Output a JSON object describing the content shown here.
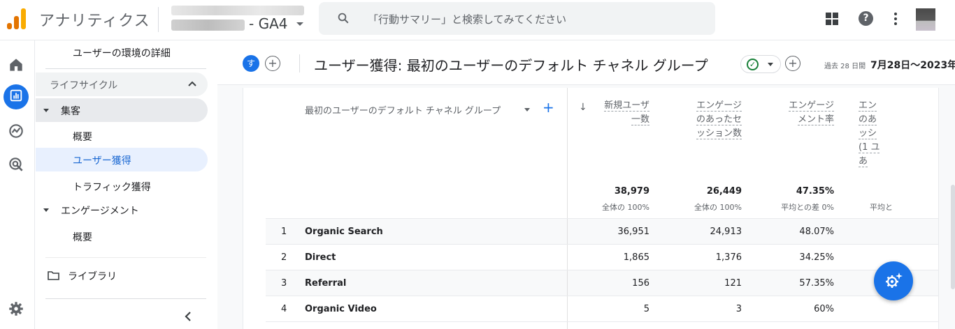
{
  "topbar": {
    "app_title": "アナリティクス",
    "property_name": "- GA4",
    "search_placeholder": "「行動サマリー」と検索してみてください"
  },
  "nav": {
    "item_env_detail": "ユーザーの環境の詳細",
    "lifecycle": "ライフサイクル",
    "acquisition": "集客",
    "acq_overview": "概要",
    "acq_user": "ユーザー獲得",
    "acq_traffic": "トラフィック獲得",
    "engagement": "エンゲージメント",
    "eng_overview": "概要",
    "library": "ライブラリ"
  },
  "header": {
    "badge": "す",
    "title": "ユーザー獲得: 最初のユーザーのデフォルト チャネル グループ",
    "date_prefix": "過去 28 日間",
    "date_range": "7月28日〜2023年8"
  },
  "table": {
    "dimension_label": "最初のユーザーのデフォルト チャネル グループ",
    "columns": [
      {
        "label": "新規ユーザ\n一数",
        "total": "38,979",
        "sub": "全体の 100%"
      },
      {
        "label": "エンゲージ\nのあったセ\nッション数",
        "total": "26,449",
        "sub": "全体の 100%"
      },
      {
        "label": "エンゲージ\nメント率",
        "total": "47.35%",
        "sub": "平均との差 0%"
      },
      {
        "label": "エン\nのあ\nッシ\n(1 ユ\nあ",
        "total": "",
        "sub": "平均と"
      }
    ],
    "rows": [
      {
        "idx": "1",
        "name": "Organic Search",
        "values": [
          "36,951",
          "24,913",
          "48.07%"
        ]
      },
      {
        "idx": "2",
        "name": "Direct",
        "values": [
          "1,865",
          "1,376",
          "34.25%"
        ]
      },
      {
        "idx": "3",
        "name": "Referral",
        "values": [
          "156",
          "121",
          "57.35%"
        ]
      },
      {
        "idx": "4",
        "name": "Organic Video",
        "values": [
          "5",
          "3",
          "60%"
        ]
      }
    ]
  },
  "colors": {
    "accent": "#1a73e8",
    "logo_orange": "#f9ab00",
    "logo_dark_orange": "#e37400"
  }
}
